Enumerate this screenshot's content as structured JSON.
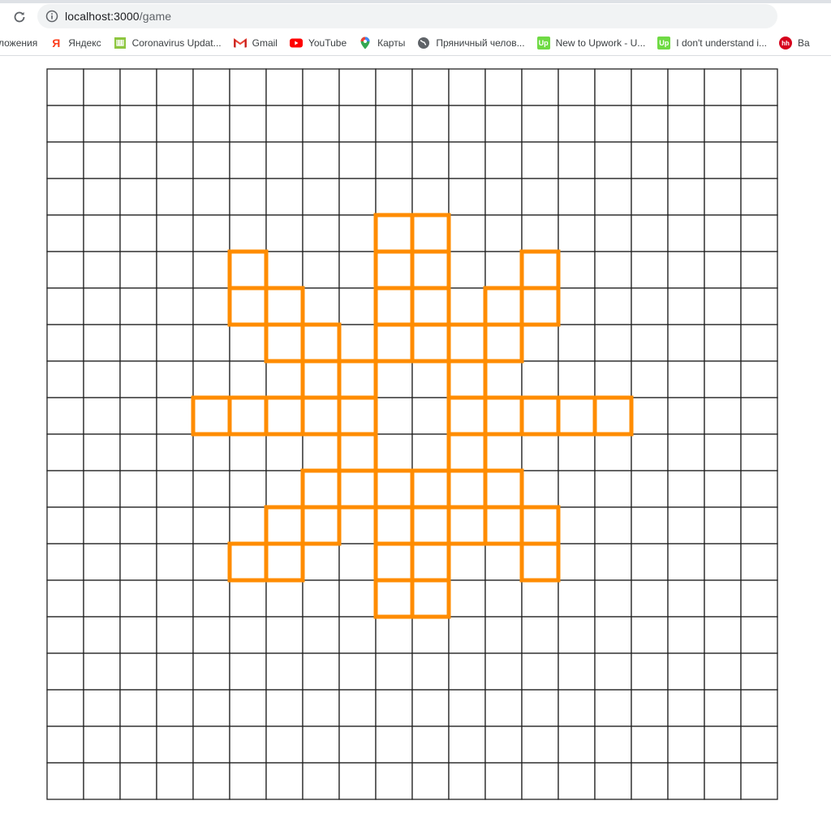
{
  "browser": {
    "url_host": "localhost:3000",
    "url_path": "/game",
    "bookmarks": [
      {
        "label": "ложения",
        "icon": "none"
      },
      {
        "label": "Яндекс",
        "icon": "yandex-icon",
        "color": "#fc3f1d"
      },
      {
        "label": "Coronavirus Updat...",
        "icon": "worldometer-icon",
        "color": "#8dc63f"
      },
      {
        "label": "Gmail",
        "icon": "gmail-icon",
        "color": "#ea4335"
      },
      {
        "label": "YouTube",
        "icon": "youtube-icon",
        "color": "#ff0000"
      },
      {
        "label": "Карты",
        "icon": "google-maps-icon",
        "color": "#34a853"
      },
      {
        "label": "Пряничный челов...",
        "icon": "globe-icon",
        "color": "#5f6368"
      },
      {
        "label": "New to Upwork - U...",
        "icon": "upwork-icon",
        "color": "#6fda44"
      },
      {
        "label": "I don't understand i...",
        "icon": "upwork-icon",
        "color": "#6fda44"
      },
      {
        "label": "Ba",
        "icon": "hh-icon",
        "color": "#d6001c"
      }
    ]
  },
  "game": {
    "grid_cols": 20,
    "grid_rows": 20,
    "grid_color": "#222222",
    "highlight_color": "#ff8c00",
    "highlighted_cells": [
      [
        9,
        4
      ],
      [
        10,
        4
      ],
      [
        9,
        5
      ],
      [
        9,
        6
      ],
      [
        9,
        7
      ],
      [
        10,
        5
      ],
      [
        10,
        6
      ],
      [
        10,
        7
      ],
      [
        5,
        5
      ],
      [
        6,
        6
      ],
      [
        7,
        7
      ],
      [
        5,
        6
      ],
      [
        6,
        7
      ],
      [
        7,
        8
      ],
      [
        13,
        5
      ],
      [
        12,
        6
      ],
      [
        11,
        7
      ],
      [
        13,
        6
      ],
      [
        12,
        7
      ],
      [
        11,
        8
      ],
      [
        4,
        9
      ],
      [
        5,
        9
      ],
      [
        6,
        9
      ],
      [
        7,
        9
      ],
      [
        8,
        9
      ],
      [
        8,
        8
      ],
      [
        8,
        10
      ],
      [
        11,
        9
      ],
      [
        12,
        9
      ],
      [
        13,
        9
      ],
      [
        14,
        9
      ],
      [
        15,
        9
      ],
      [
        11,
        8
      ],
      [
        11,
        10
      ],
      [
        7,
        11
      ],
      [
        6,
        12
      ],
      [
        5,
        13
      ],
      [
        7,
        12
      ],
      [
        6,
        13
      ],
      [
        8,
        11
      ],
      [
        11,
        11
      ],
      [
        12,
        12
      ],
      [
        13,
        13
      ],
      [
        12,
        11
      ],
      [
        13,
        12
      ],
      [
        11,
        12
      ],
      [
        9,
        11
      ],
      [
        10,
        11
      ],
      [
        9,
        12
      ],
      [
        10,
        12
      ],
      [
        9,
        13
      ],
      [
        10,
        13
      ],
      [
        9,
        14
      ],
      [
        10,
        14
      ]
    ]
  }
}
